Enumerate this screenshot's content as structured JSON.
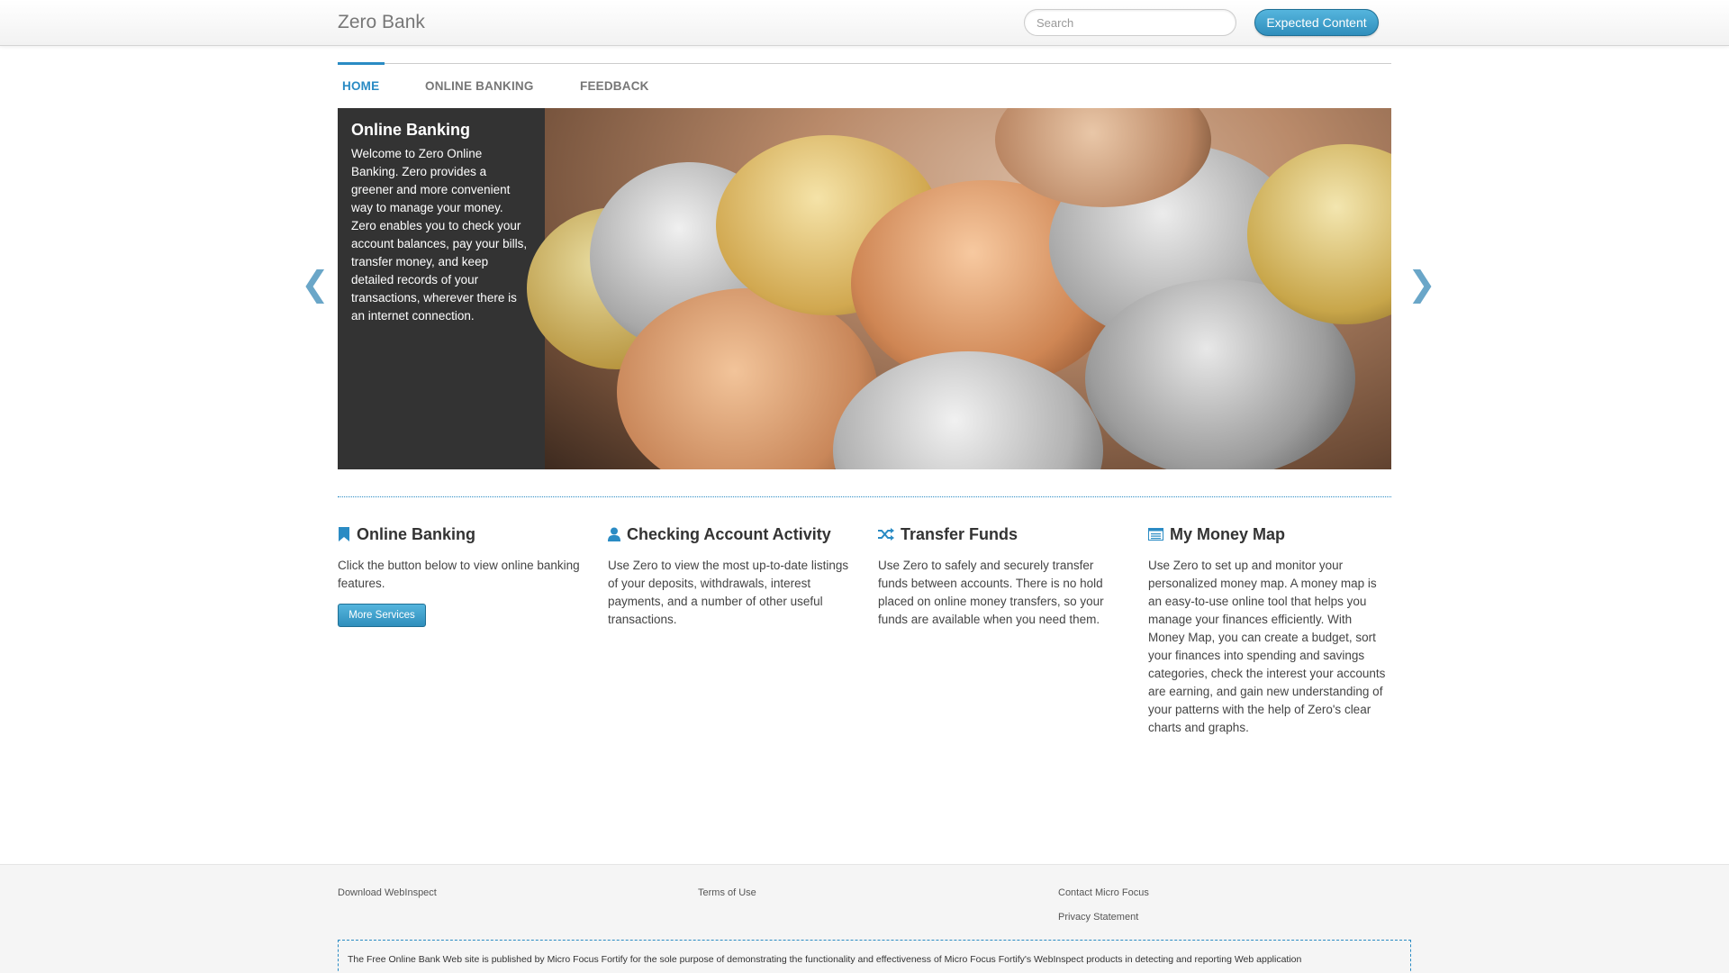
{
  "header": {
    "brand": "Zero Bank",
    "search_placeholder": "Search",
    "expected_button": "Expected Content"
  },
  "tabs": [
    {
      "label": "HOME",
      "active": true
    },
    {
      "label": "ONLINE BANKING",
      "active": false
    },
    {
      "label": "FEEDBACK",
      "active": false
    }
  ],
  "carousel": {
    "title": "Online Banking",
    "body": "Welcome to Zero Online Banking. Zero provides a greener and more convenient way to manage your money. Zero enables you to check your account balances, pay your bills, transfer money, and keep detailed records of your transactions, wherever there is an internet connection.",
    "prev_glyph": "❮",
    "next_glyph": "❯"
  },
  "features": [
    {
      "icon": "bookmark-icon",
      "title": "Online Banking",
      "body": "Click the button below to view online banking features.",
      "button": "More Services"
    },
    {
      "icon": "user-icon",
      "title": "Checking Account Activity",
      "body": "Use Zero to view the most up-to-date listings of your deposits, withdrawals, interest payments, and a number of other useful transactions."
    },
    {
      "icon": "shuffle-icon",
      "title": "Transfer Funds",
      "body": "Use Zero to safely and securely transfer funds between accounts. There is no hold placed on online money transfers, so your funds are available when you need them."
    },
    {
      "icon": "list-icon",
      "title": "My Money Map",
      "body": "Use Zero to set up and monitor your personalized money map. A money map is an easy-to-use online tool that helps you manage your finances efficiently. With Money Map, you can create a budget, sort your finances into spending and savings categories, check the interest your accounts are earning, and gain new understanding of your patterns with the help of Zero's clear charts and graphs."
    }
  ],
  "footer": {
    "download": "Download WebInspect",
    "terms": "Terms of Use",
    "contact": "Contact Micro Focus",
    "privacy": "Privacy Statement",
    "disclaimer": "The Free Online Bank Web site is published by Micro Focus Fortify for the sole purpose of demonstrating the functionality and effectiveness of Micro Focus Fortify's WebInspect products in detecting and reporting Web application"
  },
  "colors": {
    "accent": "#2a8bc4",
    "caption_bg": "#333333"
  }
}
